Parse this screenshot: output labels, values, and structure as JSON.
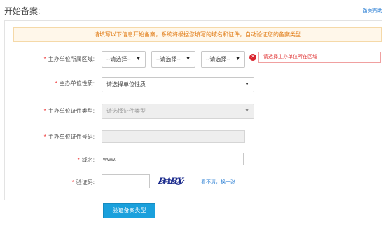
{
  "header": {
    "title": "开始备案:",
    "help_link": "备案帮助"
  },
  "notice": "请填写以下信息开始备案，系统将根据您填写的域名和证件，自动验证您的备案类型",
  "form": {
    "region": {
      "label": "主办单位所属区域:",
      "province": "--请选择--",
      "city": "--请选择--",
      "district": "--请选择--",
      "error": "请选择主办单位所在区域"
    },
    "nature": {
      "label": "主办单位性质:",
      "value": "请选择单位性质"
    },
    "cert_type": {
      "label": "主办单位证件类型:",
      "value": "请选择证件类型"
    },
    "cert_number": {
      "label": "主办单位证件号码:",
      "value": ""
    },
    "domain": {
      "label": "域名:",
      "prefix": "www.",
      "value": ""
    },
    "captcha": {
      "label": "验证码:",
      "value": "",
      "image_text": "DABX",
      "refresh": "看不清，换一张"
    },
    "submit": "验证备案类型"
  },
  "icons": {
    "error": "error-circle-icon",
    "caret": "caret-down-icon"
  },
  "colors": {
    "primary": "#1aa0dc",
    "error": "#d9232d",
    "notice_text": "#e07a12",
    "link": "#2b7fd4"
  }
}
